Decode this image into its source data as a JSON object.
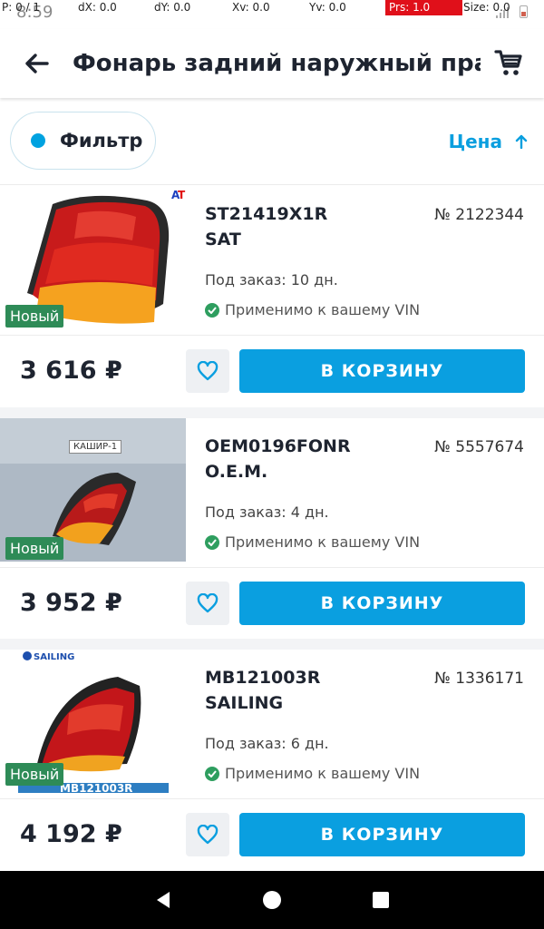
{
  "debug": {
    "p": "P: 0 / 1",
    "dx": "dX: 0.0",
    "dy": "dY: 0.0",
    "xv": "Xv: 0.0",
    "yv": "Yv: 0.0",
    "prs": "Prs: 1.0",
    "size": "Size: 0.0"
  },
  "status_bar": {
    "time": "8:59"
  },
  "header": {
    "title": "Фонарь задний наружный пра...",
    "back_icon": "arrow-left-icon",
    "cart_icon": "cart-icon"
  },
  "filter_bar": {
    "filter_label": "Фильтр",
    "sort_label": "Цена",
    "sort_icon": "arrow-up-icon",
    "accent": "#0a9fdf"
  },
  "products": [
    {
      "sku": "ST21419X1R",
      "brand": "SAT",
      "number": "№ 2122344",
      "order": "Под заказ: 10 дн.",
      "vin": "Применимо к вашему VIN",
      "badge": "Новый",
      "price": "3 616 ₽",
      "buy_label": "В КОРЗИНУ",
      "image_label": ""
    },
    {
      "sku": "OEM0196FONR",
      "brand": "O.E.M.",
      "number": "№ 5557674",
      "order": "Под заказ: 4 дн.",
      "vin": "Применимо к вашему VIN",
      "badge": "Новый",
      "price": "3 952 ₽",
      "buy_label": "В КОРЗИНУ",
      "image_label": "КАШИР-1"
    },
    {
      "sku": "MB121003R",
      "brand": "SAILING",
      "number": "№ 1336171",
      "order": "Под заказ: 6 дн.",
      "vin": "Применимо к вашему VIN",
      "badge": "Новый",
      "price": "4 192 ₽",
      "buy_label": "В КОРЗИНУ",
      "image_label": "MB121003R"
    }
  ],
  "colors": {
    "primary": "#0a9fe0",
    "badge": "#2e8b57",
    "check": "#2e9e5f"
  },
  "nav": {
    "back": "back-icon",
    "home": "home-icon",
    "recents": "recents-icon"
  }
}
